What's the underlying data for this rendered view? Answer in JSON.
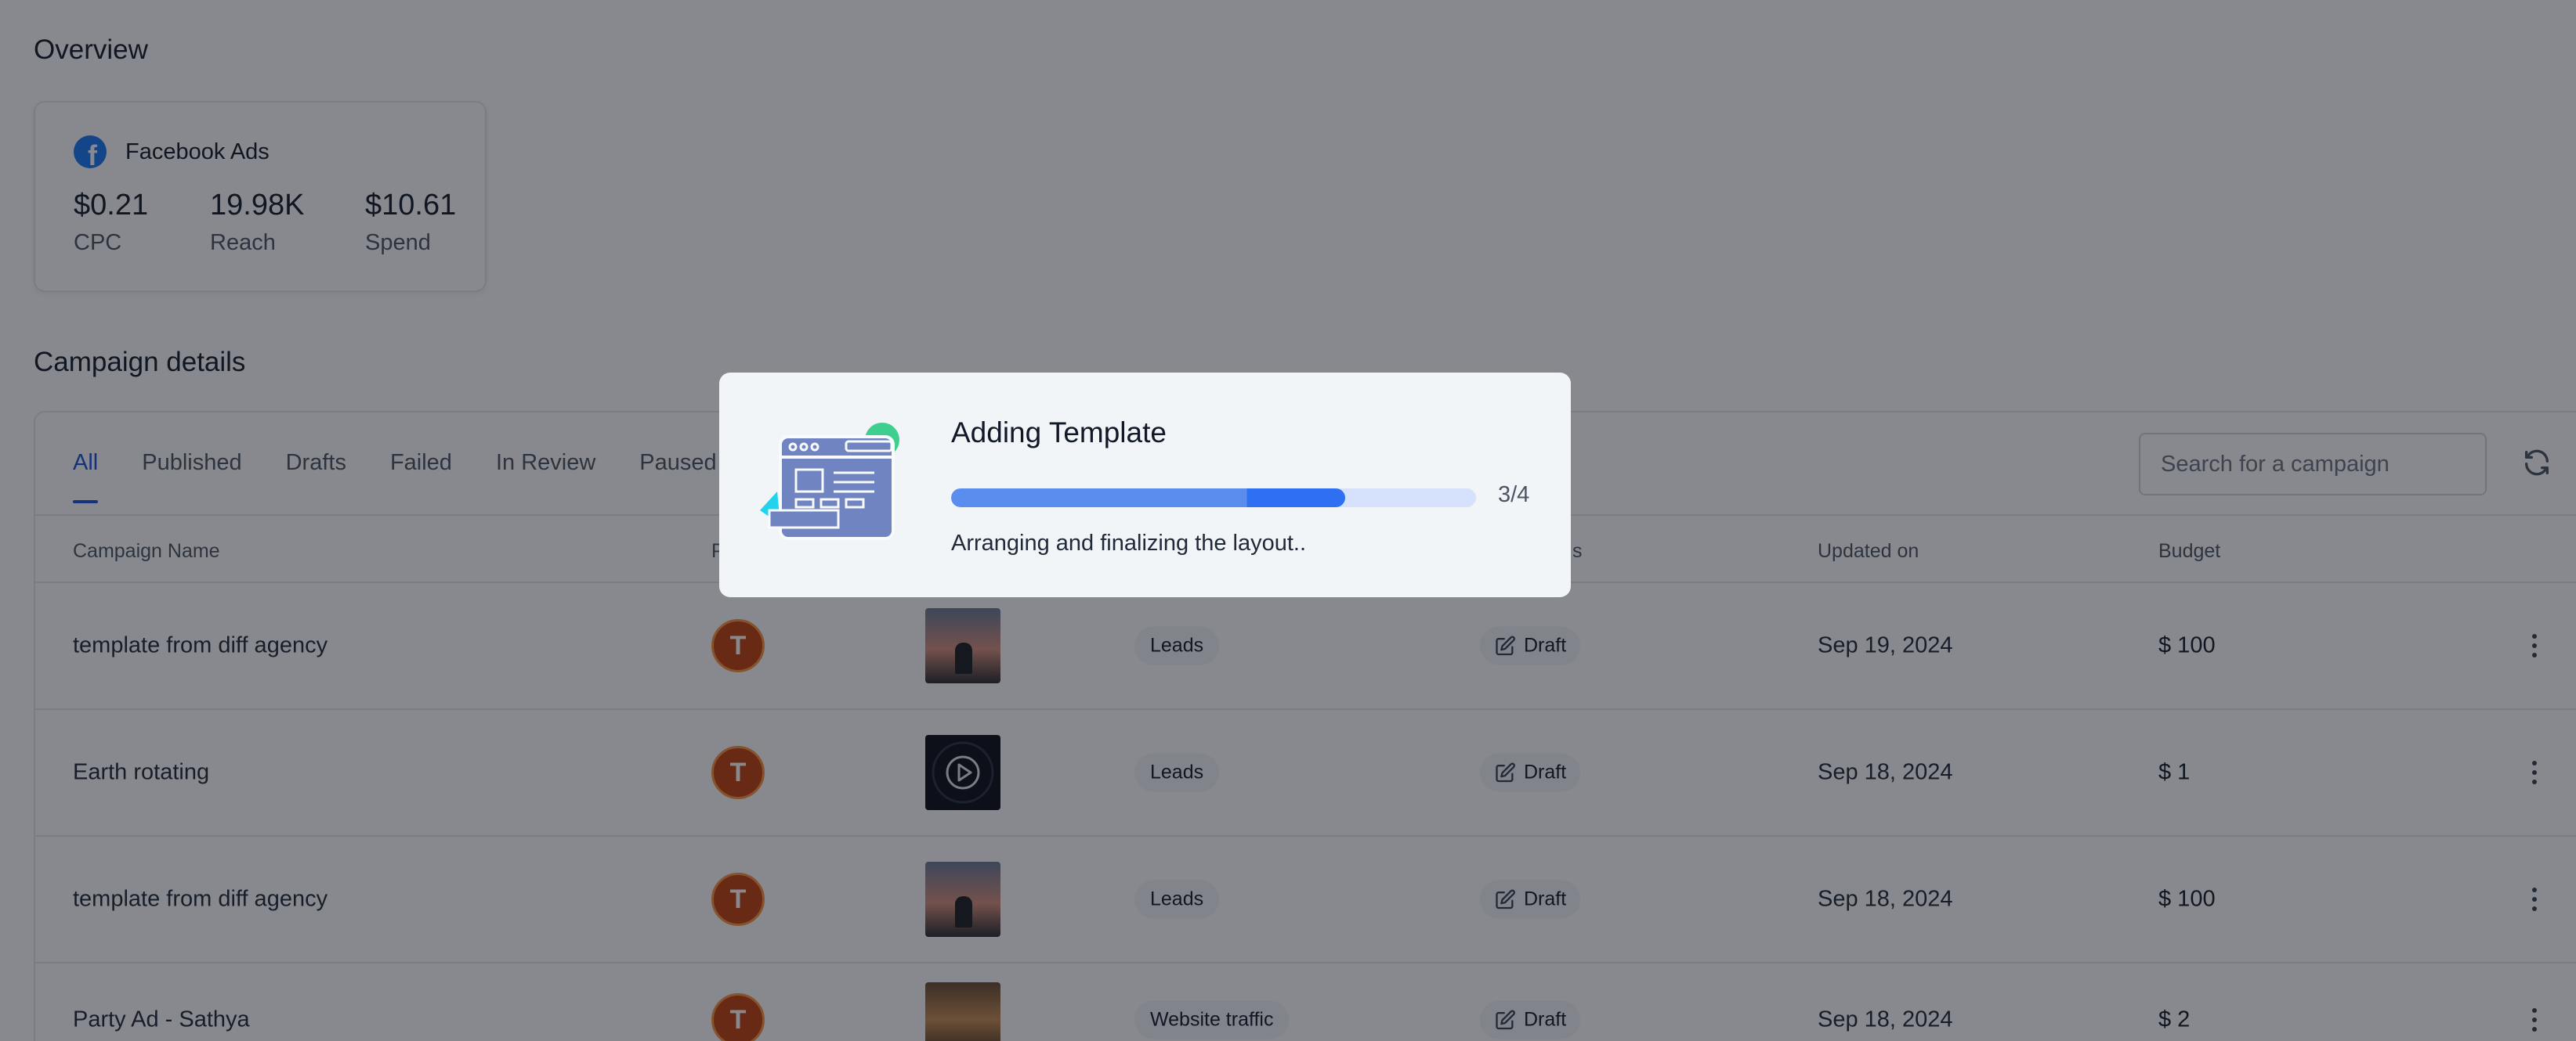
{
  "overview": {
    "title": "Overview",
    "card": {
      "platform": "Facebook Ads",
      "metrics": [
        {
          "value": "$0.21",
          "label": "CPC"
        },
        {
          "value": "19.98K",
          "label": "Reach"
        },
        {
          "value": "$10.61",
          "label": "Spend"
        }
      ]
    }
  },
  "campaigns": {
    "title": "Campaign details",
    "tabs": [
      "All",
      "Published",
      "Drafts",
      "Failed",
      "In Review",
      "Paused"
    ],
    "active_tab": "All",
    "search_placeholder": "Search for a campaign",
    "columns": [
      "Campaign Name",
      "P",
      "",
      "",
      "s",
      "Updated on",
      "Budget"
    ],
    "rows": [
      {
        "name": "template from diff agency",
        "avatar": "T",
        "thumb": "sunset",
        "objective": "Leads",
        "status": "Draft",
        "updated": "Sep 19, 2024",
        "budget": "$ 100"
      },
      {
        "name": "Earth rotating",
        "avatar": "T",
        "thumb": "video",
        "objective": "Leads",
        "status": "Draft",
        "updated": "Sep 18, 2024",
        "budget": "$ 1"
      },
      {
        "name": "template from diff agency",
        "avatar": "T",
        "thumb": "sunset",
        "objective": "Leads",
        "status": "Draft",
        "updated": "Sep 18, 2024",
        "budget": "$ 100"
      },
      {
        "name": "Party Ad - Sathya",
        "avatar": "T",
        "thumb": "party",
        "objective": "Website traffic",
        "status": "Draft",
        "updated": "Sep 18, 2024",
        "budget": "$ 2"
      }
    ]
  },
  "modal": {
    "title": "Adding Template",
    "progress_step": 3,
    "progress_total": 4,
    "progress_label": "3/4",
    "message": "Arranging and finalizing the layout.."
  },
  "colors": {
    "accent": "#1d4ed8",
    "progress_fill": "#5b8def",
    "progress_track": "#d6e2fb",
    "avatar": "#c2410c",
    "facebook": "#1877f2"
  },
  "icons": [
    "facebook-icon",
    "refresh-icon",
    "edit-icon",
    "kebab-menu-icon",
    "play-icon",
    "template-illustration-icon"
  ]
}
